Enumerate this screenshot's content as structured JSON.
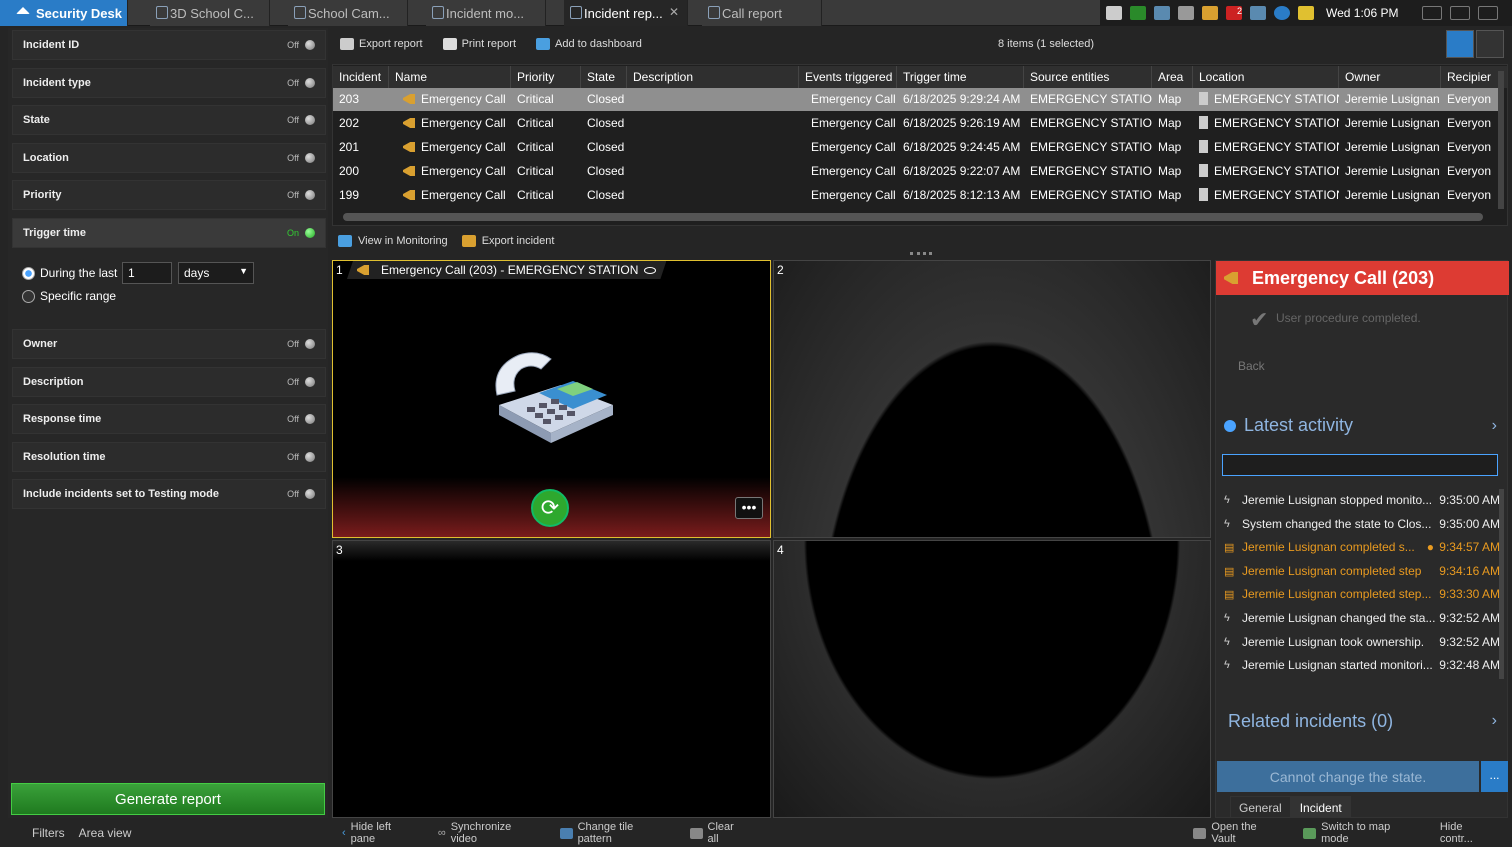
{
  "tabs": [
    {
      "label": "Security Desk"
    },
    {
      "label": "3D School C..."
    },
    {
      "label": "School Cam..."
    },
    {
      "label": "Incident mo..."
    },
    {
      "label": "Incident rep..."
    },
    {
      "label": "Call report"
    }
  ],
  "tray": {
    "clock": "Wed 1:06 PM",
    "badge": "2"
  },
  "filters": [
    {
      "label": "Incident ID",
      "state": "Off"
    },
    {
      "label": "Incident type",
      "state": "Off"
    },
    {
      "label": "State",
      "state": "Off"
    },
    {
      "label": "Location",
      "state": "Off"
    },
    {
      "label": "Priority",
      "state": "Off"
    },
    {
      "label": "Trigger time",
      "state": "On"
    },
    {
      "label": "Owner",
      "state": "Off"
    },
    {
      "label": "Description",
      "state": "Off"
    },
    {
      "label": "Response time",
      "state": "Off"
    },
    {
      "label": "Resolution time",
      "state": "Off"
    },
    {
      "label": "Include incidents set to Testing mode",
      "state": "Off"
    }
  ],
  "trigger": {
    "during_label": "During the last",
    "amount": "1",
    "unit": "days",
    "specific_label": "Specific range"
  },
  "generate_label": "Generate report",
  "left_tabs": {
    "filters": "Filters",
    "area": "Area view"
  },
  "toolbar": {
    "export": "Export report",
    "print": "Print report",
    "dashboard": "Add to dashboard",
    "count": "8 items (1 selected)"
  },
  "table": {
    "headers": [
      "Incident",
      "Name",
      "Priority",
      "State",
      "Description",
      "Events triggered",
      "Trigger time",
      "Source entities",
      "Area",
      "Location",
      "Owner",
      "Recipier"
    ],
    "rows": [
      [
        "203",
        "Emergency Call",
        "Critical",
        "Closed",
        "",
        "Emergency Call",
        "6/18/2025 9:29:24 AM",
        "EMERGENCY STATION",
        "Map",
        "EMERGENCY STATION",
        "Jeremie Lusignan",
        "Everyon"
      ],
      [
        "202",
        "Emergency Call",
        "Critical",
        "Closed",
        "",
        "Emergency Call",
        "6/18/2025 9:26:19 AM",
        "EMERGENCY STATION",
        "Map",
        "EMERGENCY STATION",
        "Jeremie Lusignan",
        "Everyon"
      ],
      [
        "201",
        "Emergency Call",
        "Critical",
        "Closed",
        "",
        "Emergency Call",
        "6/18/2025 9:24:45 AM",
        "EMERGENCY STATION",
        "Map",
        "EMERGENCY STATION",
        "Jeremie Lusignan",
        "Everyon"
      ],
      [
        "200",
        "Emergency Call",
        "Critical",
        "Closed",
        "",
        "Emergency Call",
        "6/18/2025 9:22:07 AM",
        "EMERGENCY STATION",
        "Map",
        "EMERGENCY STATION",
        "Jeremie Lusignan",
        "Everyon"
      ],
      [
        "199",
        "Emergency Call",
        "Critical",
        "Closed",
        "",
        "Emergency Call",
        "6/18/2025 8:12:13 AM",
        "EMERGENCY STATION",
        "Map",
        "EMERGENCY STATION",
        "Jeremie Lusignan",
        "Everyon"
      ]
    ]
  },
  "actions": {
    "monitoring": "View in Monitoring",
    "export_incident": "Export incident"
  },
  "tiles": {
    "t1_num": "1",
    "t1_title": "Emergency Call (203) - EMERGENCY STATION",
    "t2_num": "2",
    "t3_num": "3",
    "t4_num": "4"
  },
  "incident": {
    "title": "Emergency Call (203)",
    "procedure": "User procedure completed.",
    "back": "Back",
    "latest": "Latest activity",
    "related": "Related incidents (0)",
    "cannot": "Cannot change the state.",
    "more": "...",
    "activity": [
      {
        "text": "Jeremie Lusignan stopped monito...",
        "time": "9:35:00 AM",
        "kind": "event"
      },
      {
        "text": "System changed the state to Clos...",
        "time": "9:35:00 AM",
        "kind": "event"
      },
      {
        "text": "Jeremie Lusignan completed s...",
        "time": "9:34:57 AM",
        "kind": "step"
      },
      {
        "text": "Jeremie Lusignan completed step",
        "time": "9:34:16 AM",
        "kind": "step"
      },
      {
        "text": "Jeremie Lusignan completed step...",
        "time": "9:33:30 AM",
        "kind": "step"
      },
      {
        "text": "Jeremie Lusignan changed the sta...",
        "time": "9:32:52 AM",
        "kind": "event"
      },
      {
        "text": "Jeremie Lusignan took ownership.",
        "time": "9:32:52 AM",
        "kind": "event"
      },
      {
        "text": "Jeremie Lusignan started monitori...",
        "time": "9:32:48 AM",
        "kind": "event"
      }
    ],
    "tabs": [
      "General",
      "Incident"
    ]
  },
  "footer": {
    "hide_left": "Hide left pane",
    "sync": "Synchronize video",
    "tile_pattern": "Change tile pattern",
    "clear": "Clear all",
    "vault": "Open the Vault",
    "map": "Switch to map mode",
    "hide_controls": "Hide contr..."
  },
  "colors": {
    "accent": "#2a7cc7",
    "alarm": "#dd3b33",
    "on": "#2ea82e",
    "activity_step": "#e89a20"
  }
}
